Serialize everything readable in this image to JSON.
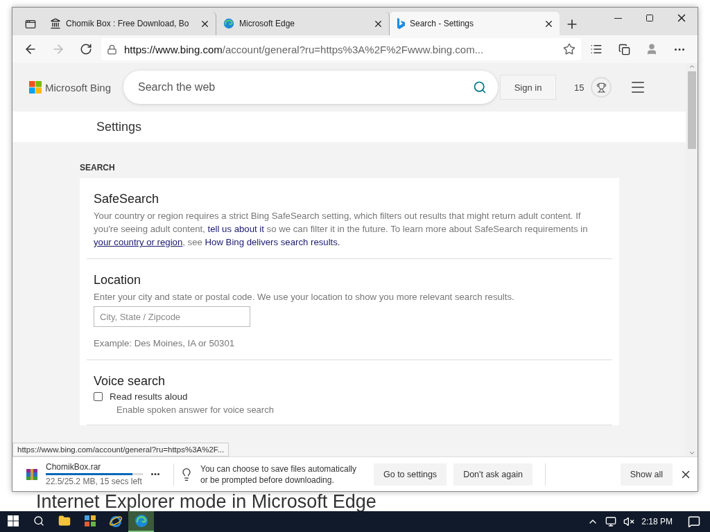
{
  "browser": {
    "tabs": [
      {
        "title": "Chomik Box : Free Download, Bo",
        "selected": false,
        "kind": "site"
      },
      {
        "title": "Microsoft Edge",
        "selected": false,
        "kind": "edge"
      },
      {
        "title": "Search - Settings",
        "selected": true,
        "kind": "bing"
      }
    ],
    "address": {
      "host": "https://www.bing.com",
      "path": "/account/general?ru=https%3A%2F%2Fwww.bing.com..."
    },
    "status_url": "https://www.bing.com/account/general?ru=https%3A%2F..."
  },
  "bing": {
    "logo": "Microsoft Bing",
    "search": {
      "placeholder": "Search the web"
    },
    "sign_in": "Sign in",
    "points": "15"
  },
  "settings_title": "Settings",
  "section_label": "SEARCH",
  "sections": [
    {
      "kind": "text",
      "title": "SafeSearch",
      "description": [
        {
          "kind": "text",
          "text": "Your country or region requires a strict Bing SafeSearch setting, which filters out results that might return adult content. If you're seeing adult content, "
        },
        {
          "kind": "link",
          "text": "tell us about it"
        },
        {
          "kind": "text",
          "text": " so we can filter it in the future. To learn more about SafeSearch requirements in "
        },
        {
          "kind": "underlined",
          "text": "your country or region"
        },
        {
          "kind": "text",
          "text": ", see "
        },
        {
          "kind": "link",
          "text": "How Bing delivers search results."
        }
      ]
    },
    {
      "kind": "location",
      "title": "Location",
      "description": [
        {
          "kind": "text",
          "text": "Enter your city and state or postal code. We use your location to show you more relevant search results."
        }
      ],
      "input": {
        "placeholder": "City, State / Zipcode"
      },
      "example": "Example: Des Moines, IA or 50301"
    },
    {
      "kind": "checkbox",
      "title": "Voice search",
      "option": {
        "label": "Read results aloud",
        "checked": false,
        "hint": "Enable spoken answer for voice search"
      }
    }
  ],
  "download": {
    "file": "ChomikBox.rar",
    "level": 0.89,
    "progress": "22.5/25.2 MB, 15 secs left",
    "message": "You can choose to save files automatically or be prompted before downloading.",
    "buttons": [
      "Go to settings",
      "Don't ask again"
    ],
    "show_all": "Show all"
  },
  "background_heading": "Internet Explorer mode in Microsoft Edge",
  "taskbar": {
    "apps": [
      {
        "kind": "explorer",
        "selected": false
      },
      {
        "kind": "control",
        "selected": false
      },
      {
        "kind": "ie",
        "selected": false
      },
      {
        "kind": "edge",
        "selected": true
      }
    ],
    "time": "2:18 PM"
  }
}
